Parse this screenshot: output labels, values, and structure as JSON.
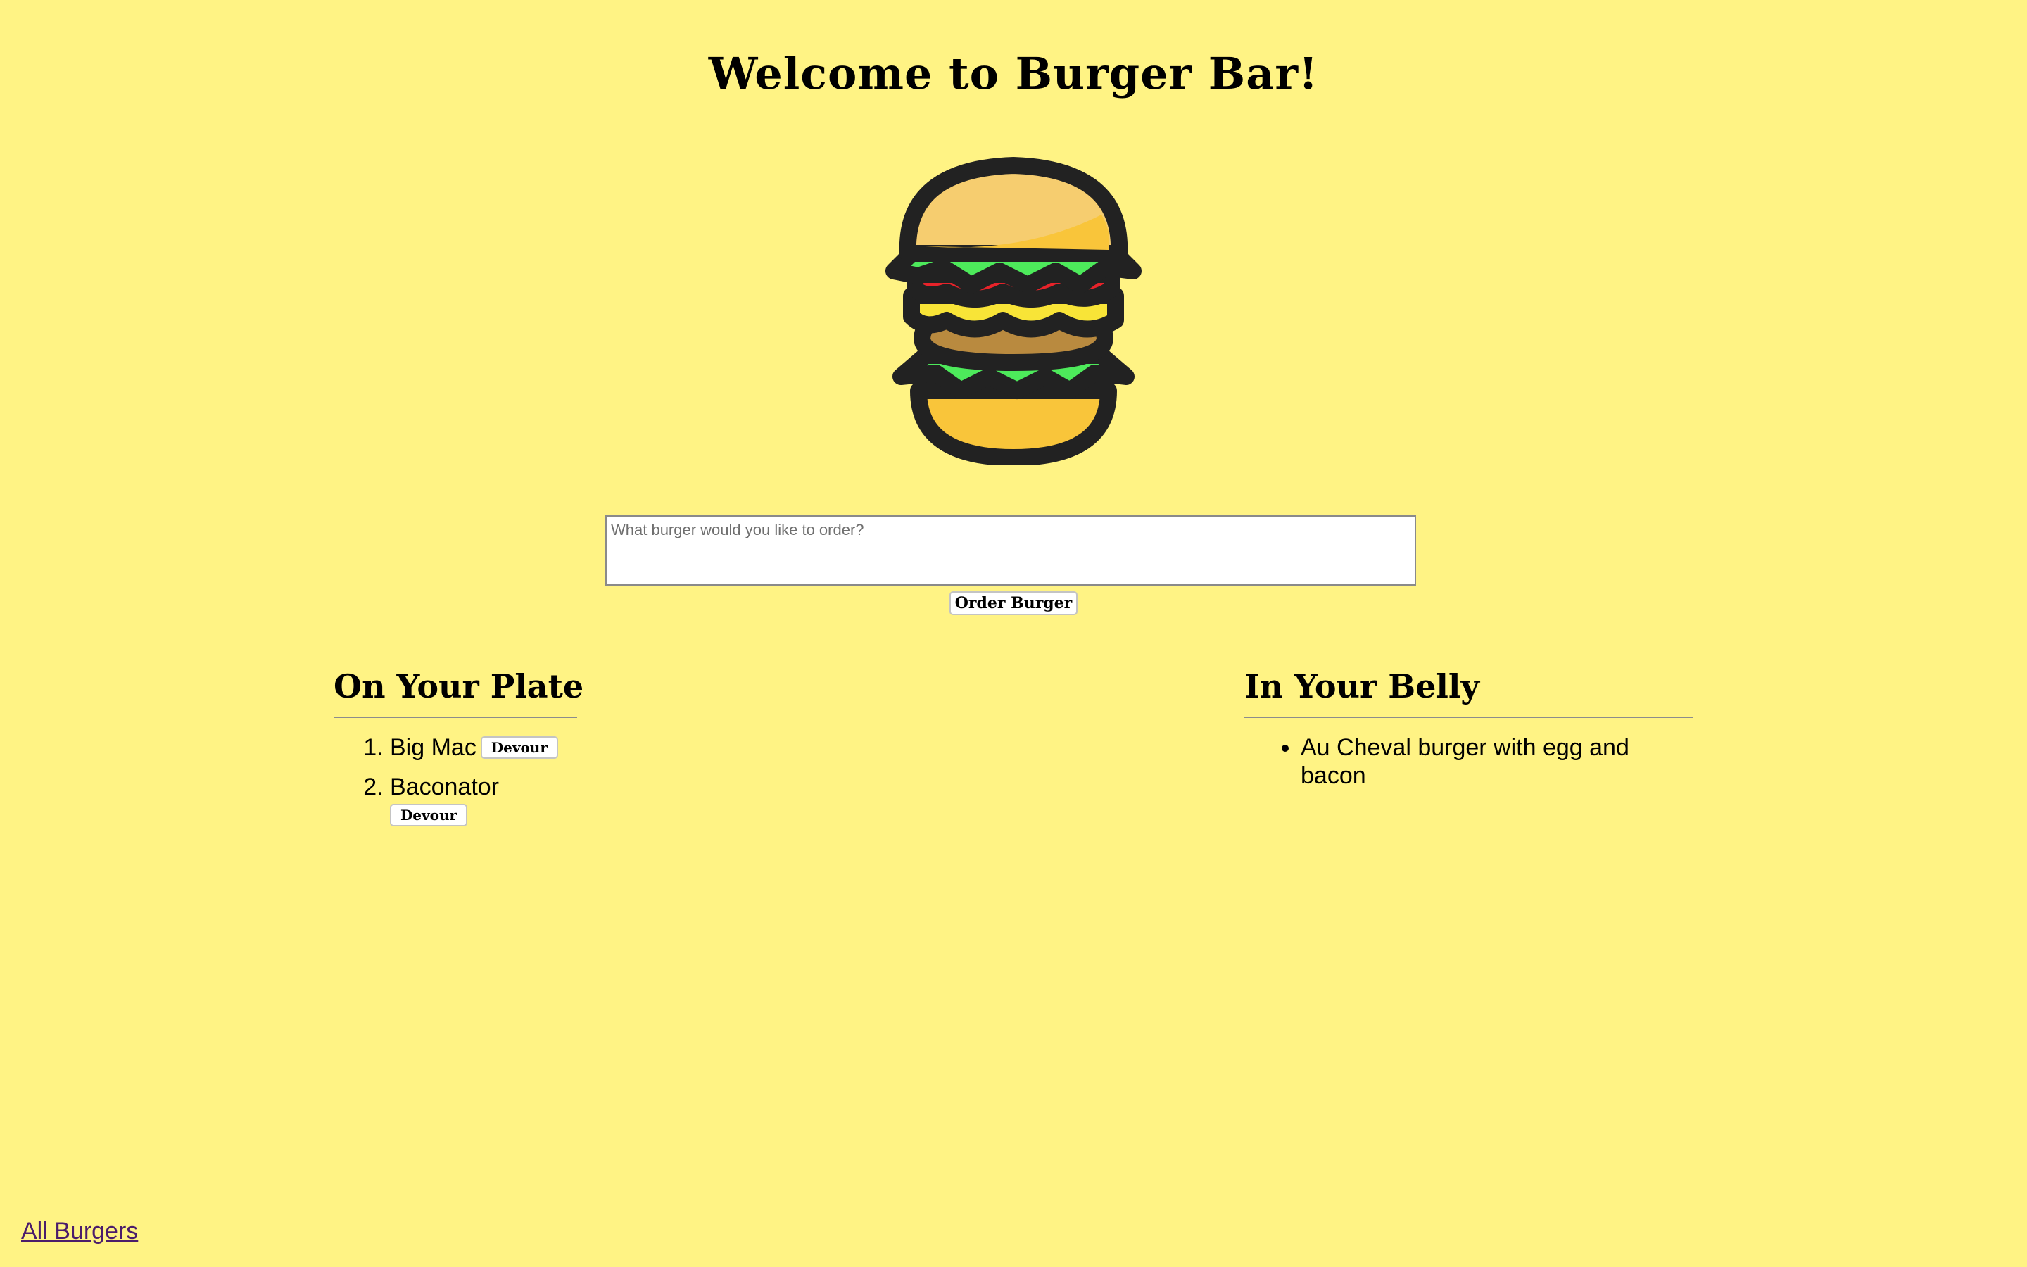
{
  "header": {
    "title": "Welcome to Burger Bar!"
  },
  "order_form": {
    "placeholder": "What burger would you like to order?",
    "value": "",
    "submit_label": "Order Burger"
  },
  "plate": {
    "title": "On Your Plate",
    "items": [
      {
        "name": "Big Mac",
        "action_label": "Devour"
      },
      {
        "name": "Baconator",
        "action_label": "Devour"
      }
    ]
  },
  "belly": {
    "title": "In Your Belly",
    "items": [
      {
        "name": "Au Cheval burger with egg and bacon"
      }
    ]
  },
  "footer": {
    "link_label": "All Burgers"
  },
  "colors": {
    "background": "#fff384",
    "bun": "#f6cd6f",
    "lettuce": "#4dea5b",
    "tomato": "#e8232a",
    "cheese": "#f8e437",
    "patty": "#b98a3f",
    "outline": "#222222"
  },
  "icons": {
    "logo": "burger-icon"
  }
}
